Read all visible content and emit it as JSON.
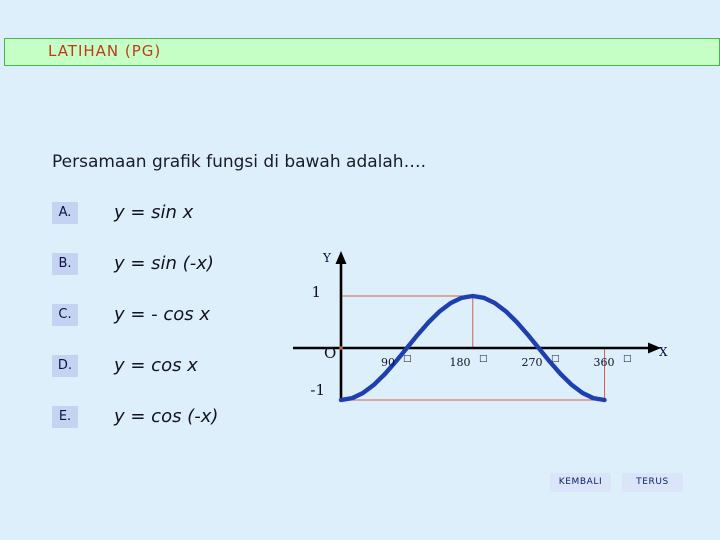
{
  "header": {
    "title": "LATIHAN  (PG)",
    "banner_fill": "#c6ffc6",
    "banner_border": "#4cb44c",
    "title_color": "#c0391b"
  },
  "page": {
    "background": "#deeffc"
  },
  "question": {
    "text": "Persamaan grafik fungsi di bawah adalah…."
  },
  "options": [
    {
      "letter": "A.",
      "formula": "y =  sin x"
    },
    {
      "letter": "B.",
      "formula": "y =  sin (-x)"
    },
    {
      "letter": "C.",
      "formula": "y = - cos x"
    },
    {
      "letter": "D.",
      "formula": "y =  cos x"
    },
    {
      "letter": "E.",
      "formula": "y =  cos (-x)"
    }
  ],
  "chart_data": {
    "type": "line",
    "title": "",
    "xlabel": "X",
    "ylabel": "Y",
    "origin_label": "O",
    "xlim": [
      0,
      360
    ],
    "ylim": [
      -1,
      1
    ],
    "grid": false,
    "legend": null,
    "x_tick_labels": [
      "90",
      "180",
      "270",
      "360"
    ],
    "x_tick_values": [
      90,
      180,
      270,
      360
    ],
    "degree_symbol": "□",
    "y_tick_labels": [
      "1",
      "-1"
    ],
    "y_tick_values": [
      1,
      -1
    ],
    "curve_color": "#1d3faf",
    "guide_color": "#d4604a",
    "axis_color": "#000000",
    "series": [
      {
        "name": "y = - cos x",
        "x": [
          0,
          15,
          30,
          45,
          60,
          75,
          90,
          105,
          120,
          135,
          150,
          165,
          180,
          195,
          210,
          225,
          240,
          255,
          270,
          285,
          300,
          315,
          330,
          345,
          360
        ],
        "values": [
          -1,
          -0.966,
          -0.866,
          -0.707,
          -0.5,
          -0.259,
          0,
          0.259,
          0.5,
          0.707,
          0.866,
          0.966,
          1,
          0.966,
          0.866,
          0.707,
          0.5,
          0.259,
          0,
          -0.259,
          -0.5,
          -0.707,
          -0.866,
          -0.966,
          -1
        ]
      }
    ],
    "annotations": [
      {
        "name": "guide-y-top",
        "type": "hline",
        "y": 1,
        "x_from": 0,
        "x_to": 180
      },
      {
        "name": "guide-y-bottom",
        "type": "hline",
        "y": -1,
        "x_from": 0,
        "x_to": 360
      },
      {
        "name": "guide-x-180",
        "type": "vline",
        "x": 180,
        "y_from": 0,
        "y_to": 1
      },
      {
        "name": "guide-x-360",
        "type": "vline",
        "x": 360,
        "y_from": -1,
        "y_to": 0
      }
    ]
  },
  "nav": {
    "back_label": "KEMBALI",
    "next_label": "TERUS"
  }
}
